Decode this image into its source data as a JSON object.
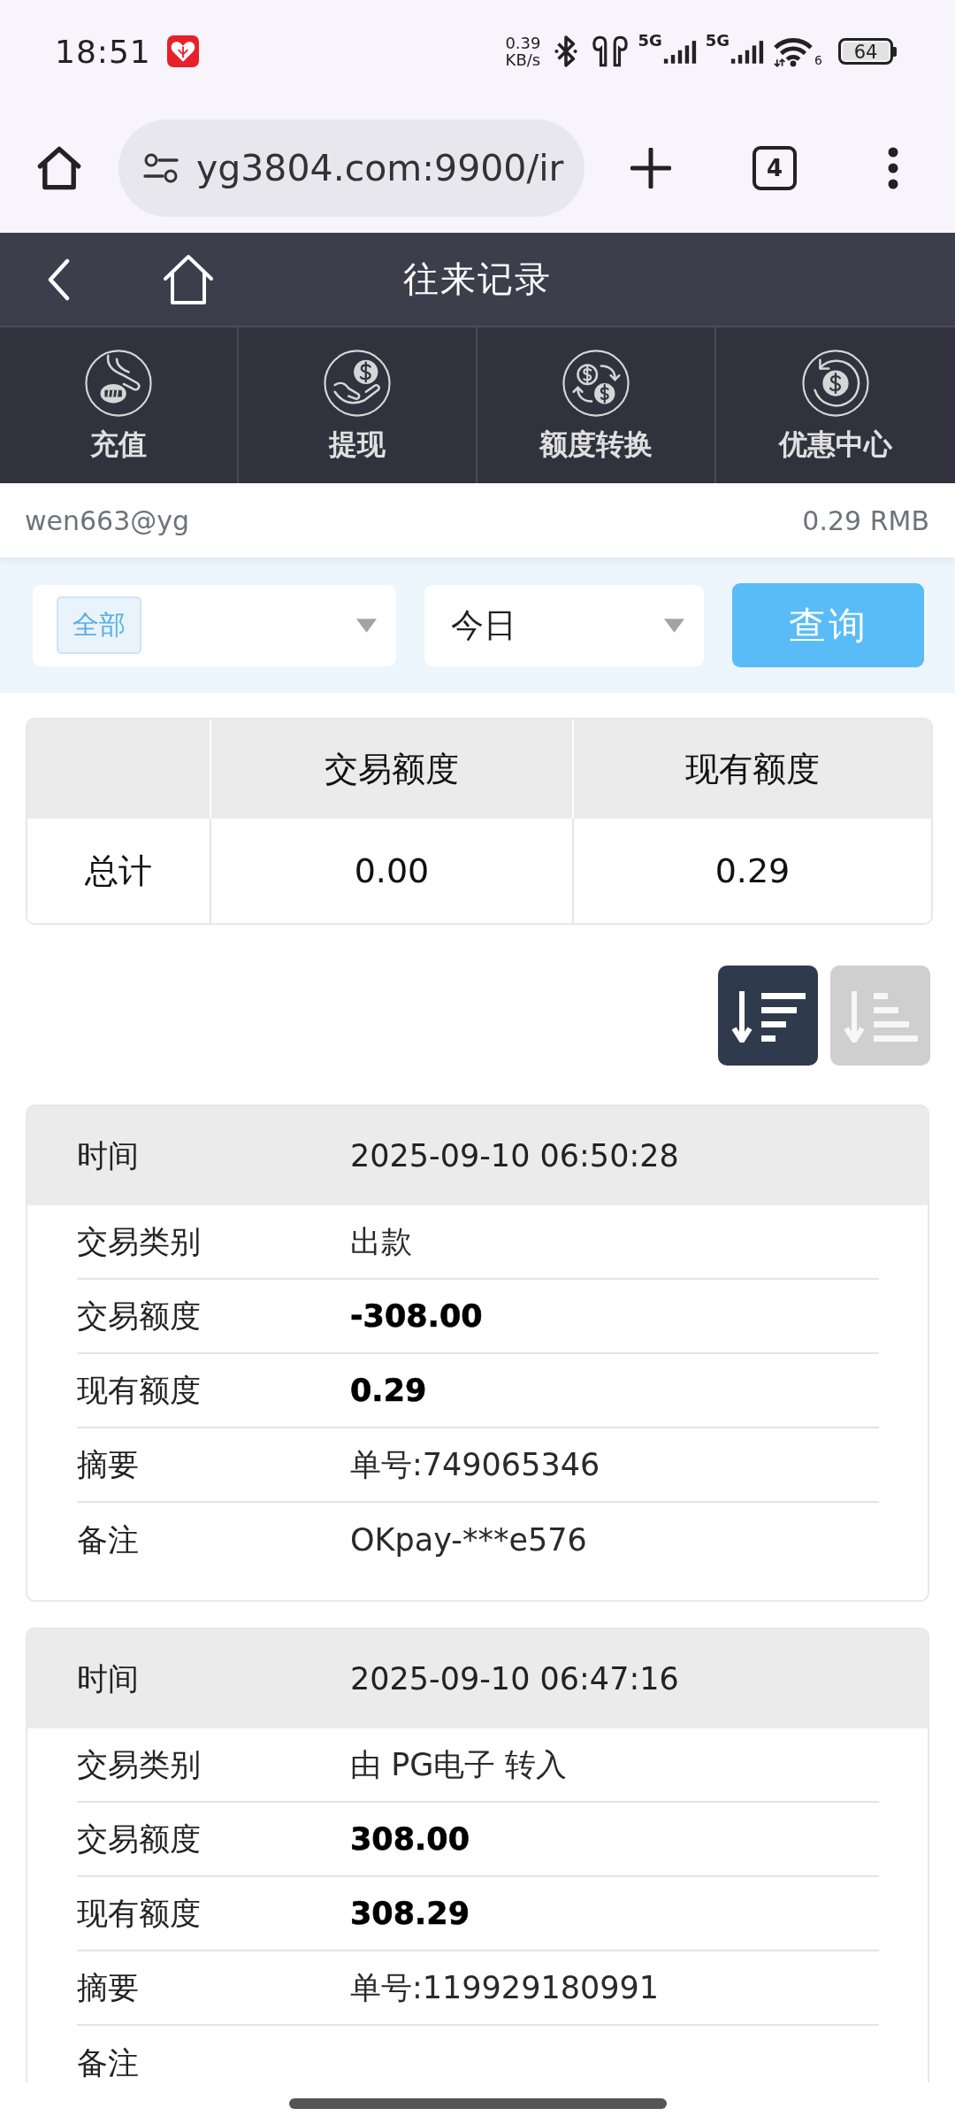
{
  "status_bar": {
    "time": "18:51",
    "net_speed": [
      "0.39",
      "KB/s"
    ],
    "sim_signals": [
      {
        "label": "5G"
      },
      {
        "label": "5G"
      }
    ],
    "wifi_label": "6",
    "battery": "64"
  },
  "browser": {
    "url": "yg3804.com:9900/ir",
    "tab_count": "4"
  },
  "header": {
    "title": "往来记录"
  },
  "nav": [
    {
      "label": "充值",
      "kind": "deposit"
    },
    {
      "label": "提现",
      "kind": "withdraw"
    },
    {
      "label": "额度转换",
      "kind": "transfer"
    },
    {
      "label": "优惠中心",
      "kind": "promo"
    }
  ],
  "account": {
    "user": "wen663@yg",
    "balance": "0.29 RMB"
  },
  "filters": {
    "type": "全部",
    "period": "今日",
    "query_button": "查询"
  },
  "summary": {
    "columns": [
      "交易额度",
      "现有额度"
    ],
    "rows": [
      {
        "label": "总计",
        "cells": [
          "0.00",
          "0.29"
        ]
      }
    ]
  },
  "sort_buttons": [
    {
      "kind": "descending",
      "selected": true
    },
    {
      "kind": "ascending",
      "selected": false
    }
  ],
  "records": [
    {
      "header": {
        "label": "时间",
        "value": "2025-09-10 06:50:28"
      },
      "fields": [
        {
          "label": "交易类别",
          "value": "出款",
          "bold": false
        },
        {
          "label": "交易额度",
          "value": "-308.00",
          "bold": true
        },
        {
          "label": "现有额度",
          "value": "0.29",
          "bold": true
        },
        {
          "label": "摘要",
          "value": "单号:749065346",
          "bold": false
        },
        {
          "label": "备注",
          "value": "OKpay-***e576",
          "bold": false
        }
      ]
    },
    {
      "header": {
        "label": "时间",
        "value": "2025-09-10 06:47:16"
      },
      "fields": [
        {
          "label": "交易类别",
          "value": "由 PG电子 转入",
          "bold": false
        },
        {
          "label": "交易额度",
          "value": "308.00",
          "bold": true
        },
        {
          "label": "现有额度",
          "value": "308.29",
          "bold": true
        },
        {
          "label": "摘要",
          "value": "单号:119929180991",
          "bold": false
        },
        {
          "label": "备注"
        }
      ]
    }
  ]
}
